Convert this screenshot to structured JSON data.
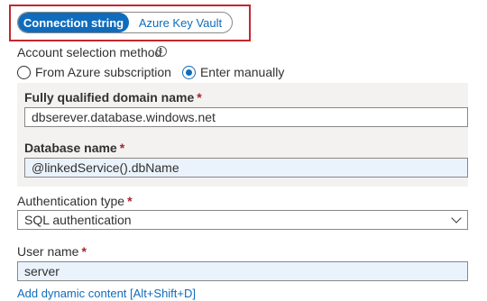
{
  "source_toggle": {
    "options": [
      "Connection string",
      "Azure Key Vault"
    ],
    "selected": "Connection string"
  },
  "account_selection": {
    "label": "Account selection method",
    "info_icon": "info-icon",
    "options": [
      "From Azure subscription",
      "Enter manually"
    ],
    "selected": "Enter manually"
  },
  "fqdn": {
    "label": "Fully qualified domain name",
    "required_mark": "*",
    "value": "dbserever.database.windows.net"
  },
  "database": {
    "label": "Database name",
    "required_mark": "*",
    "value": "@linkedService().dbName"
  },
  "auth": {
    "label": "Authentication type",
    "required_mark": "*",
    "value": "SQL authentication",
    "chevron_icon": "chevron-down-icon"
  },
  "username": {
    "label": "User name",
    "required_mark": "*",
    "value": "server"
  },
  "dynamic_link": "Add dynamic content [Alt+Shift+D]",
  "colors": {
    "accent": "#0f6cbd",
    "highlight_border": "#c4262e",
    "required": "#a4262c",
    "panel_bg": "#f3f2f1",
    "dynamic_input_bg": "#eaf3fb"
  }
}
